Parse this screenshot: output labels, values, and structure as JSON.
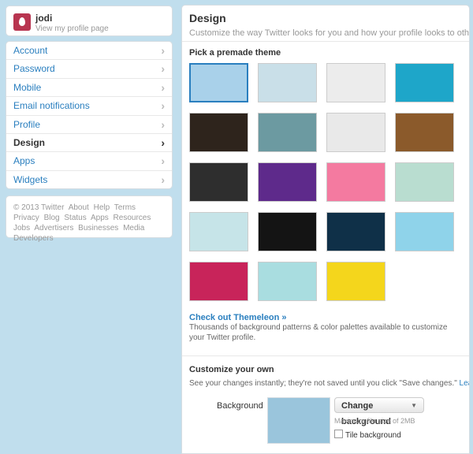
{
  "profile": {
    "name": "jodi",
    "sub": "View my profile page"
  },
  "nav": {
    "items": [
      {
        "label": "Account"
      },
      {
        "label": "Password"
      },
      {
        "label": "Mobile"
      },
      {
        "label": "Email notifications"
      },
      {
        "label": "Profile"
      },
      {
        "label": "Design",
        "active": true
      },
      {
        "label": "Apps"
      },
      {
        "label": "Widgets"
      }
    ],
    "chevron": "›"
  },
  "footer": {
    "copyright": "© 2013 Twitter",
    "links": [
      "About",
      "Help",
      "Terms",
      "Privacy",
      "Blog",
      "Status",
      "Apps",
      "Resources",
      "Jobs",
      "Advertisers",
      "Businesses",
      "Media",
      "Developers"
    ]
  },
  "main": {
    "title": "Design",
    "subtitle": "Customize the way Twitter looks for you and how your profile looks to others.",
    "premade_label": "Pick a premade theme",
    "themes": [
      {
        "name": "sky-clouds",
        "color": "#a9d1ea",
        "selected": true
      },
      {
        "name": "bare-tree",
        "color": "#c9dfe8"
      },
      {
        "name": "green-vine",
        "color": "#ececec"
      },
      {
        "name": "sparkles",
        "color": "#1ea6c9"
      },
      {
        "name": "green-leaves",
        "color": "#2e241c"
      },
      {
        "name": "teal-texture",
        "color": "#6c9aa1"
      },
      {
        "name": "red-plant",
        "color": "#e9e9e9"
      },
      {
        "name": "birds-gold",
        "color": "#8b5a2b"
      },
      {
        "name": "dark-ornament",
        "color": "#2e2e2e"
      },
      {
        "name": "purple-stars",
        "color": "#5e2a8b"
      },
      {
        "name": "pink-flowers",
        "color": "#f47aa0"
      },
      {
        "name": "red-leaf",
        "color": "#b9ddd0"
      },
      {
        "name": "green-leaves-sky",
        "color": "#c6e4e8"
      },
      {
        "name": "black-hex",
        "color": "#141414"
      },
      {
        "name": "navy-rays",
        "color": "#0f3048"
      },
      {
        "name": "blue-bokeh",
        "color": "#8fd3ea"
      },
      {
        "name": "magenta",
        "color": "#c8245a"
      },
      {
        "name": "flying-birds",
        "color": "#a9dde0"
      },
      {
        "name": "yellow-leaves",
        "color": "#f4d61c"
      }
    ],
    "themeleon_link": "Check out Themeleon »",
    "themeleon_desc": "Thousands of background patterns & color palettes available to customize your Twitter profile.",
    "custom_title": "Customize your own",
    "custom_desc": "See your changes instantly; they're not saved until you click \"Save changes.\"",
    "learn_more": "Learn more.",
    "background_label": "Background",
    "background_color": "#9ac5dc",
    "change_bg_button": "Change background",
    "max_size": "Maximum file size of 2MB",
    "tile_label": "Tile background",
    "tile_checked": false
  },
  "colors": {
    "page_bg": "#c0deed",
    "link": "#2a7fbf",
    "avatar": "#b83550"
  }
}
